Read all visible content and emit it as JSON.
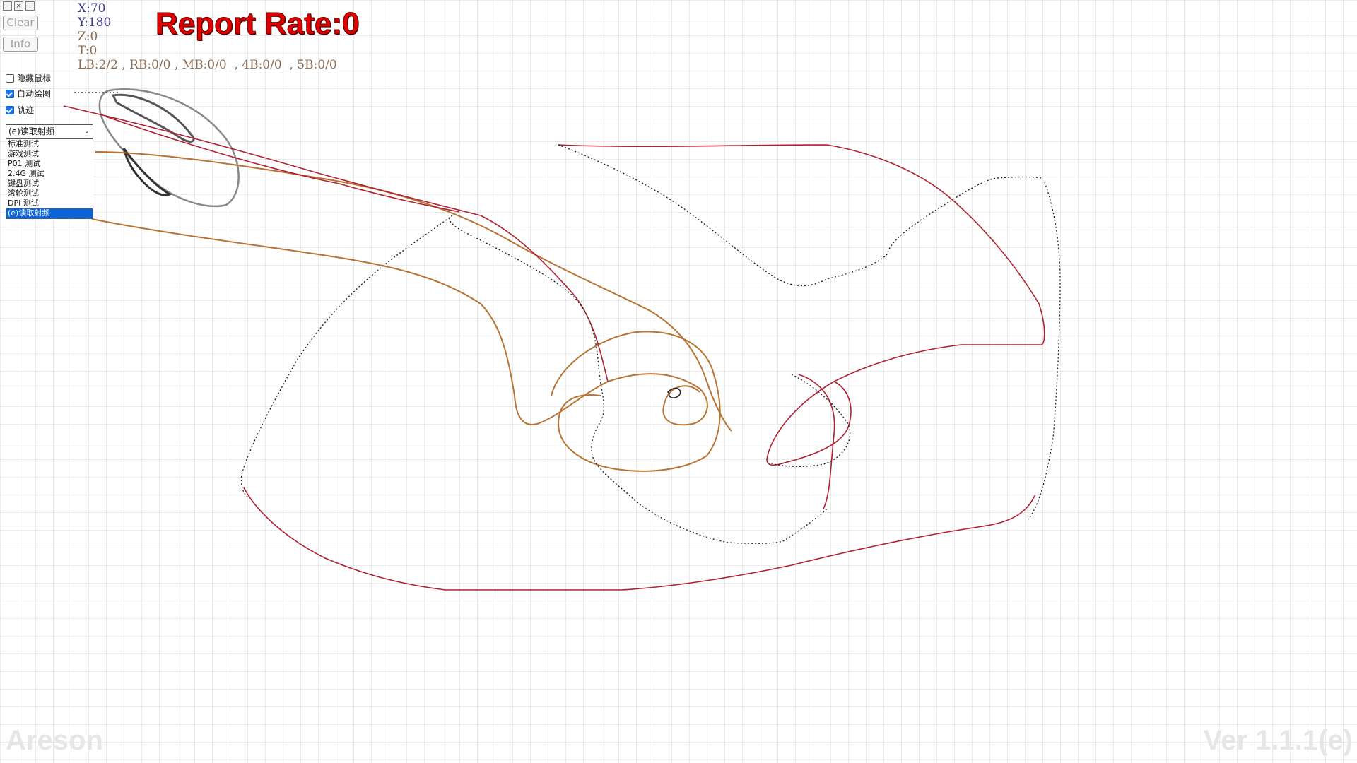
{
  "window_icons": [
    "minimize-icon",
    "close-icon",
    "info-icon"
  ],
  "window_icon_glyphs": [
    "–",
    "×",
    "!"
  ],
  "buttons": {
    "clear": "Clear",
    "info": "Info"
  },
  "coords": {
    "x": "X:70",
    "y": "Y:180",
    "z": "Z:0",
    "t": "T:0"
  },
  "button_counts": "LB:2/2 , RB:0/0 , MB:0/0  , 4B:0/0  , 5B:0/0",
  "report_rate": "Report Rate:0",
  "options": {
    "hide_cursor": {
      "label": "隐藏鼠标",
      "checked": false
    },
    "auto_draw": {
      "label": "自动绘图",
      "checked": true
    },
    "trace": {
      "label": "轨迹",
      "checked": true
    }
  },
  "select": {
    "value": "(e)读取射频",
    "options": [
      "标准测试",
      "游戏测试",
      "P01 测试",
      "2.4G 测试",
      "键盘测试",
      "滚轮测试",
      "DPI 测试",
      "(e)读取射频"
    ],
    "selected_index": 7
  },
  "watermark": {
    "brand": "Areson",
    "version": "Ver 1.1.1(e)"
  },
  "colors": {
    "report_rate": "#e00000",
    "trace_dark": "#1a1a1a",
    "trace_red": "#b02030",
    "trace_brown": "#b87333",
    "mouse_outline": "#555555"
  }
}
